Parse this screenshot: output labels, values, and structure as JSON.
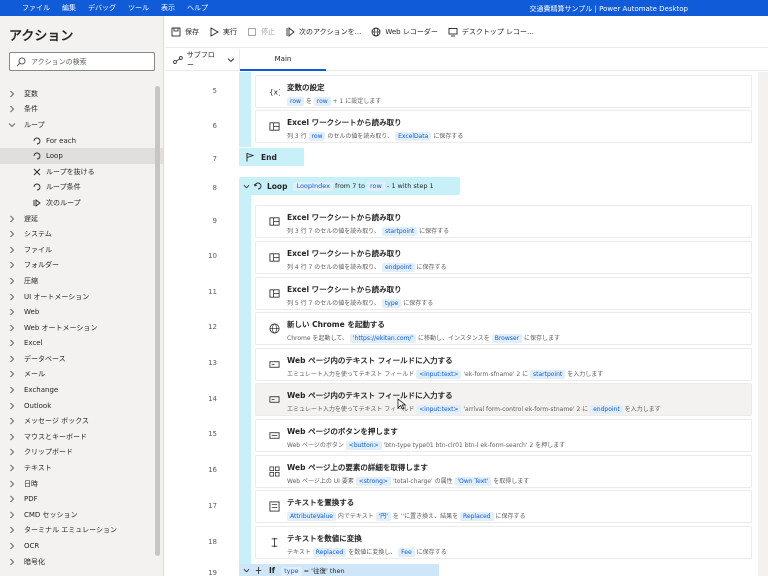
{
  "titlebar": {
    "menu": [
      "ファイル",
      "編集",
      "デバッグ",
      "ツール",
      "表示",
      "ヘルプ"
    ],
    "title": "交通費精算サンプル | Power Automate Desktop"
  },
  "sidebar": {
    "title": "アクション",
    "search_placeholder": "アクションの検索",
    "items": [
      {
        "label": "変数",
        "type": "group"
      },
      {
        "label": "条件",
        "type": "group"
      },
      {
        "label": "ループ",
        "type": "group-open"
      },
      {
        "label": "For each",
        "type": "child",
        "icon": "loop-icon"
      },
      {
        "label": "Loop",
        "type": "child",
        "icon": "loop-icon",
        "selected": true
      },
      {
        "label": "ループを抜ける",
        "type": "child",
        "icon": "x-icon"
      },
      {
        "label": "ループ条件",
        "type": "child",
        "icon": "loop-icon"
      },
      {
        "label": "次のループ",
        "type": "child",
        "icon": "next-icon"
      },
      {
        "label": "遅延",
        "type": "group"
      },
      {
        "label": "システム",
        "type": "group"
      },
      {
        "label": "ファイル",
        "type": "group"
      },
      {
        "label": "フォルダー",
        "type": "group"
      },
      {
        "label": "圧縮",
        "type": "group"
      },
      {
        "label": "UI オートメーション",
        "type": "group"
      },
      {
        "label": "Web",
        "type": "group"
      },
      {
        "label": "Web オートメーション",
        "type": "group"
      },
      {
        "label": "Excel",
        "type": "group"
      },
      {
        "label": "データベース",
        "type": "group"
      },
      {
        "label": "メール",
        "type": "group"
      },
      {
        "label": "Exchange",
        "type": "group"
      },
      {
        "label": "Outlook",
        "type": "group"
      },
      {
        "label": "メッセージ ボックス",
        "type": "group"
      },
      {
        "label": "マウスとキーボード",
        "type": "group"
      },
      {
        "label": "クリップボード",
        "type": "group"
      },
      {
        "label": "テキスト",
        "type": "group"
      },
      {
        "label": "日時",
        "type": "group"
      },
      {
        "label": "PDF",
        "type": "group"
      },
      {
        "label": "CMD セッション",
        "type": "group"
      },
      {
        "label": "ターミナル エミュレーション",
        "type": "group"
      },
      {
        "label": "OCR",
        "type": "group"
      },
      {
        "label": "暗号化",
        "type": "group"
      }
    ]
  },
  "toolbar": {
    "save": "保存",
    "run": "実行",
    "stop": "停止",
    "next_action": "次のアクションを...",
    "web_recorder": "Web レコーダー",
    "desktop_recorder": "デスクトップ レコー..."
  },
  "subflow": {
    "label": "サブフロー",
    "tab": "Main"
  },
  "flow": {
    "line5": {
      "no": "5",
      "title": "変数の設定",
      "desc": [
        "row",
        "を",
        "row",
        "+ 1 に設定します"
      ]
    },
    "line6": {
      "no": "6",
      "title": "Excel ワークシートから読み取り",
      "desc": [
        "列 3 行",
        "row",
        "のセルの値を読み取り、",
        "ExcelData",
        "に保存する"
      ]
    },
    "line7": {
      "no": "7",
      "title": "End"
    },
    "line8": {
      "no": "8",
      "title": "Loop",
      "var": "LoopIndex",
      "from": "from 7 to",
      "to": "row",
      "step": "- 1 with step 1"
    },
    "line9": {
      "no": "9",
      "title": "Excel ワークシートから読み取り",
      "desc": [
        "列 3 行 7 のセルの値を読み取り、",
        "startpoint",
        "に保存する"
      ]
    },
    "line10": {
      "no": "10",
      "title": "Excel ワークシートから読み取り",
      "desc": [
        "列 4 行 7 のセルの値を読み取り、",
        "endpoint",
        "に保存する"
      ]
    },
    "line11": {
      "no": "11",
      "title": "Excel ワークシートから読み取り",
      "desc": [
        "列 5 行 7 のセルの値を読み取り、",
        "type",
        "に保存する"
      ]
    },
    "line12": {
      "no": "12",
      "title": "新しい Chrome を起動する",
      "desc": [
        "Chrome を起動して、",
        "'https://ekitan.com/'",
        "に移動し、インスタンスを",
        "Browser",
        "に保存します"
      ]
    },
    "line13": {
      "no": "13",
      "title": "Web ページ内のテキスト フィールドに入力する",
      "desc": [
        "エミュレート入力を使ってテキスト フィールド",
        "<input:text>",
        "'ek-form-sfname' 2 に",
        "startpoint",
        "を入力します"
      ]
    },
    "line14": {
      "no": "14",
      "title": "Web ページ内のテキスト フィールドに入力する",
      "desc": [
        "エミュレート入力を使ってテキスト フィールド",
        "<input:text>",
        "'arrival form-control ek-form-stname' 2 に",
        "endpoint",
        "を入力します"
      ]
    },
    "line15": {
      "no": "15",
      "title": "Web ページのボタンを押します",
      "desc": [
        "Web ページのボタン",
        "<button>",
        "'btn-type type01 btn-clr01 btn-l ek-form-search' 2 を押します"
      ]
    },
    "line16": {
      "no": "16",
      "title": "Web ページ上の要素の詳細を取得します",
      "desc": [
        "Web ページ上の UI 要素",
        "<strong>",
        "'total-charge' の属性",
        "'Own Text'",
        "を取得します"
      ]
    },
    "line17": {
      "no": "17",
      "title": "テキストを置換する",
      "desc": [
        "AttributeValue",
        "内でテキスト",
        "'円'",
        "を ''に置き換え、結果を",
        "Replaced",
        "に保存する"
      ]
    },
    "line18": {
      "no": "18",
      "title": "テキストを数値に変換",
      "desc": [
        "テキスト",
        "Replaced",
        "を数値に変換し、",
        "Fee",
        "に保存する"
      ]
    },
    "line19": {
      "no": "19",
      "title": "If",
      "var": "type",
      "op": "= '往復' then"
    }
  }
}
